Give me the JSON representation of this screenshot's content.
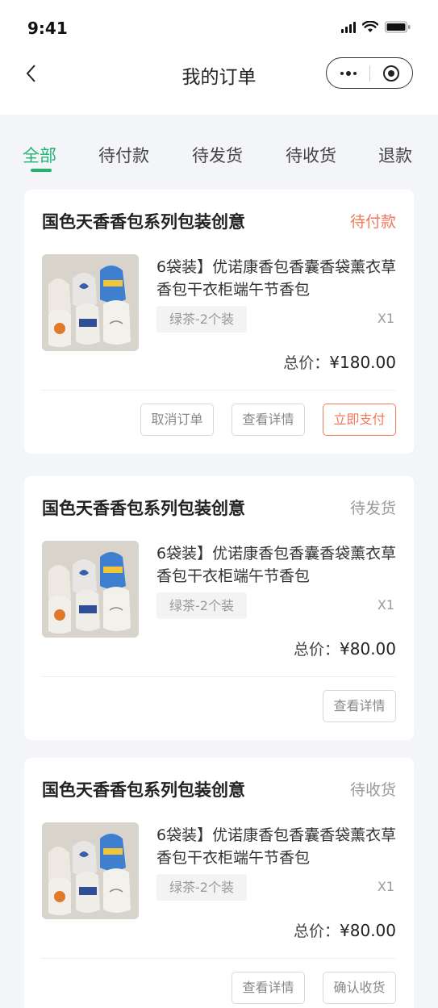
{
  "status_bar": {
    "time": "9:41"
  },
  "nav": {
    "title": "我的订单"
  },
  "tabs": [
    "全部",
    "待付款",
    "待发货",
    "待收货",
    "退款"
  ],
  "colors": {
    "accent": "#1fb56e",
    "pay": "#f07a5c"
  },
  "orders": [
    {
      "shop": "国色天香香包系列包装创意",
      "status": "待付款",
      "product_title": "6袋装】优诺康香包香囊香袋薰衣草香包干衣柜端午节香包",
      "spec": "绿茶-2个装",
      "qty": "X1",
      "total_label": "总价：",
      "total_price": "¥180.00",
      "buttons": [
        "取消订单",
        "查看详情",
        "立即支付"
      ]
    },
    {
      "shop": "国色天香香包系列包装创意",
      "status": "待发货",
      "product_title": "6袋装】优诺康香包香囊香袋薰衣草香包干衣柜端午节香包",
      "spec": "绿茶-2个装",
      "qty": "X1",
      "total_label": "总价：",
      "total_price": "¥80.00",
      "buttons": [
        "查看详情"
      ]
    },
    {
      "shop": "国色天香香包系列包装创意",
      "status": "待收货",
      "product_title": "6袋装】优诺康香包香囊香袋薰衣草香包干衣柜端午节香包",
      "spec": "绿茶-2个装",
      "qty": "X1",
      "total_label": "总价：",
      "total_price": "¥80.00",
      "buttons": [
        "查看详情",
        "确认收货"
      ]
    }
  ]
}
